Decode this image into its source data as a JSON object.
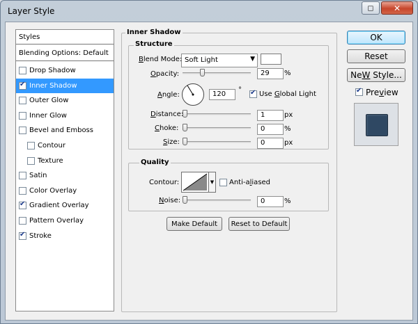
{
  "window": {
    "title": "Layer Style"
  },
  "styles_list": {
    "header": "Styles",
    "blending": "Blending Options: Default",
    "items": [
      {
        "label": "Drop Shadow",
        "checked": false,
        "selected": false,
        "indent": false
      },
      {
        "label": "Inner Shadow",
        "checked": true,
        "selected": true,
        "indent": false
      },
      {
        "label": "Outer Glow",
        "checked": false,
        "selected": false,
        "indent": false
      },
      {
        "label": "Inner Glow",
        "checked": false,
        "selected": false,
        "indent": false
      },
      {
        "label": "Bevel and Emboss",
        "checked": false,
        "selected": false,
        "indent": false
      },
      {
        "label": "Contour",
        "checked": false,
        "selected": false,
        "indent": true
      },
      {
        "label": "Texture",
        "checked": false,
        "selected": false,
        "indent": true
      },
      {
        "label": "Satin",
        "checked": false,
        "selected": false,
        "indent": false
      },
      {
        "label": "Color Overlay",
        "checked": false,
        "selected": false,
        "indent": false
      },
      {
        "label": "Gradient Overlay",
        "checked": true,
        "selected": false,
        "indent": false
      },
      {
        "label": "Pattern Overlay",
        "checked": false,
        "selected": false,
        "indent": false
      },
      {
        "label": "Stroke",
        "checked": true,
        "selected": false,
        "indent": false
      }
    ]
  },
  "inner_shadow": {
    "panel_title": "Inner Shadow",
    "structure": {
      "title": "Structure",
      "blend_mode_label_u": "B",
      "blend_mode_label_rest": "lend Mode:",
      "blend_mode_value": "Soft Light",
      "opacity_label_u": "O",
      "opacity_label_rest": "pacity:",
      "opacity_value": "29",
      "opacity_unit": "%",
      "opacity_fraction": 0.29,
      "angle_label_u": "A",
      "angle_label_rest": "ngle:",
      "angle_value": "120",
      "angle_unit": "°",
      "use_global_light_label_u": "G",
      "use_global_light_label_pre": "Use ",
      "use_global_light_label_rest": "lobal Light",
      "use_global_light_checked": true,
      "distance_label_u": "D",
      "distance_label_rest": "istance:",
      "distance_value": "1",
      "distance_unit": "px",
      "choke_label_u": "C",
      "choke_label_rest": "hoke:",
      "choke_value": "0",
      "choke_unit": "%",
      "size_label_u": "S",
      "size_label_rest": "ize:",
      "size_value": "0",
      "size_unit": "px"
    },
    "quality": {
      "title": "Quality",
      "contour_label": "Contour:",
      "anti_aliased_label_pre": "Anti-a",
      "anti_aliased_label_u": "l",
      "anti_aliased_label_rest": "iased",
      "anti_aliased_checked": false,
      "noise_label_u": "N",
      "noise_label_rest": "oise:",
      "noise_value": "0",
      "noise_unit": "%"
    },
    "make_default": "Make Default",
    "reset_to_default": "Reset to Default"
  },
  "actions": {
    "ok": "OK",
    "reset": "Reset",
    "new_style_u": "W",
    "new_style_pre": "Ne",
    "new_style_rest": " Style...",
    "preview_label_u": "v",
    "preview_label_pre": "Pre",
    "preview_label_rest": "iew",
    "preview_checked": true
  },
  "colors": {
    "selection": "#3399ff",
    "preview_swatch": "#2f4863",
    "shadow_color": "#ffffff"
  }
}
